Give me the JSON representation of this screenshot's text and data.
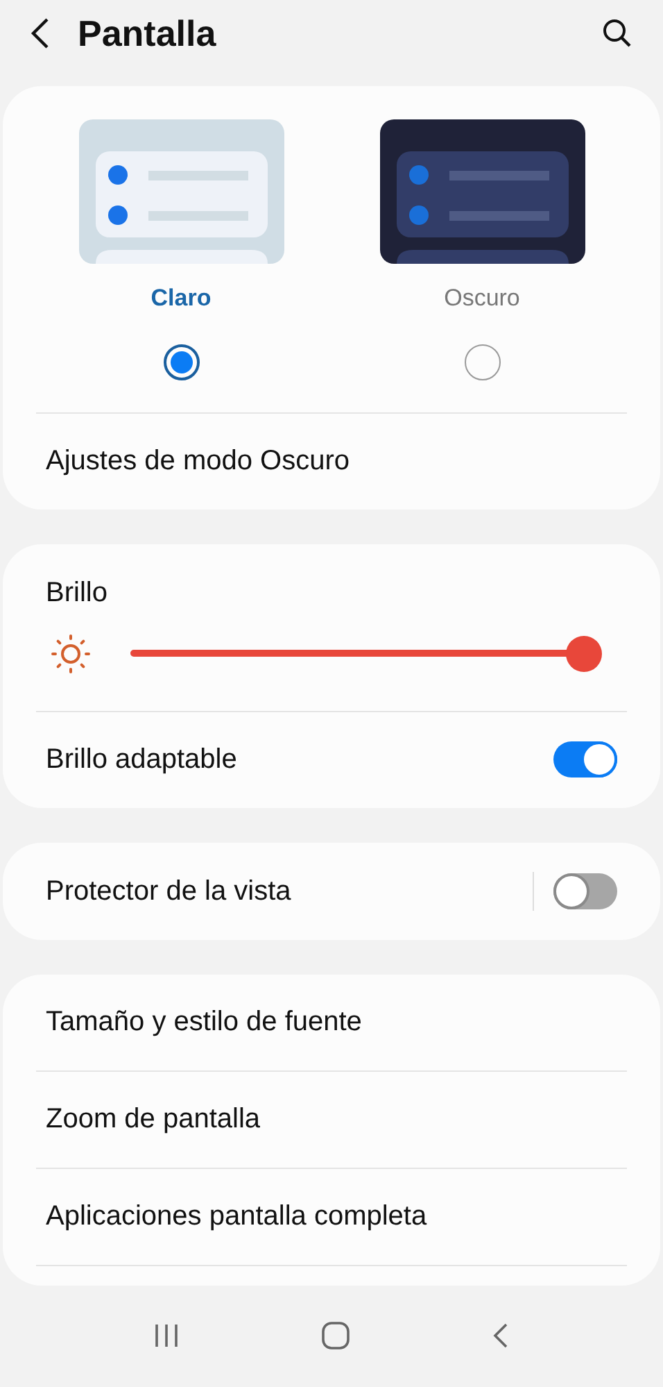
{
  "header": {
    "title": "Pantalla"
  },
  "theme": {
    "options": [
      {
        "label": "Claro",
        "kind": "light",
        "selected": true
      },
      {
        "label": "Oscuro",
        "kind": "dark",
        "selected": false
      }
    ],
    "dark_mode_settings": "Ajustes de modo Oscuro"
  },
  "brightness": {
    "label": "Brillo",
    "level": 1.0,
    "adaptive": {
      "label": "Brillo adaptable",
      "on": true
    }
  },
  "eye_comfort": {
    "label": "Protector de la vista",
    "on": false
  },
  "list": [
    {
      "label": "Tamaño y estilo de fuente"
    },
    {
      "label": "Zoom de pantalla"
    },
    {
      "label": "Aplicaciones pantalla completa"
    }
  ]
}
